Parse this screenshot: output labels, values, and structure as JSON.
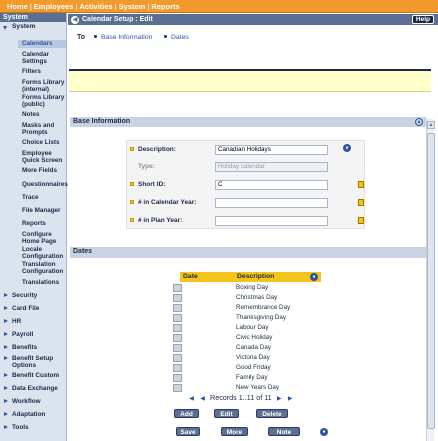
{
  "topnav": {
    "items": [
      "Home",
      "Employees",
      "Activities",
      "System",
      "Reports"
    ],
    "separator": "|"
  },
  "leftnav": {
    "header": "System",
    "open_section": "System",
    "sub_items": [
      "Calendars",
      "Calendar Settings",
      "Filters",
      "Forms Library (internal)",
      "Forms Library (public)",
      "Notes",
      "Masks and Prompts",
      "Choice Lists",
      "Employee Quick Screen",
      "More Fields",
      "Questionnaires",
      "Trace",
      "File Manager",
      "Reports",
      "Configure Home Page",
      "Locale Configuration",
      "Translation Configuration",
      "Translations"
    ],
    "active_item": "Calendars",
    "sections": [
      "Security",
      "Card File",
      "HR",
      "Payroll",
      "Benefits",
      "Benefit Setup Options",
      "Benefit Custom",
      "Data Exchange",
      "Workflow",
      "Adaptation",
      "Tools"
    ]
  },
  "titlebar": {
    "title": "Calendar Setup : Edit",
    "help_label": "Help"
  },
  "to_nav": {
    "label": "To",
    "links": [
      "Base Information",
      "Dates"
    ]
  },
  "base_info": {
    "header": "Base Information",
    "fields": [
      {
        "label": "Description:",
        "value": "Canadian Holidays",
        "required": true
      },
      {
        "label": "Type:",
        "value": "Holiday calendar",
        "required": false
      },
      {
        "label": "Short ID:",
        "value": "C",
        "required": true
      },
      {
        "label": "# in Calendar Year:",
        "value": "",
        "required": true
      },
      {
        "label": "# in Plan Year:",
        "value": "",
        "required": true
      }
    ]
  },
  "dates": {
    "header": "Dates",
    "col_date": "Date",
    "col_description": "Description",
    "rows": [
      "Boxing Day",
      "Christmas Day",
      "Remembrance Day",
      "Thanksgiving Day",
      "Labour Day",
      "Civic Holiday",
      "Canada Day",
      "Victoria Day",
      "Good Friday",
      "Family Day",
      "New Years Day"
    ],
    "pager_text": "Records 1..11 of 11",
    "add_label": "Add",
    "edit_label": "Edit",
    "delete_label": "Delete"
  },
  "footer": {
    "save_label": "Save",
    "more_label": "More",
    "note_label": "Note"
  },
  "colors": {
    "topbar": "#f39a2c",
    "nav_blue": "#5b6e94",
    "highlight_yellow": "#f3c51a",
    "message_bar": "#ffffc8"
  }
}
